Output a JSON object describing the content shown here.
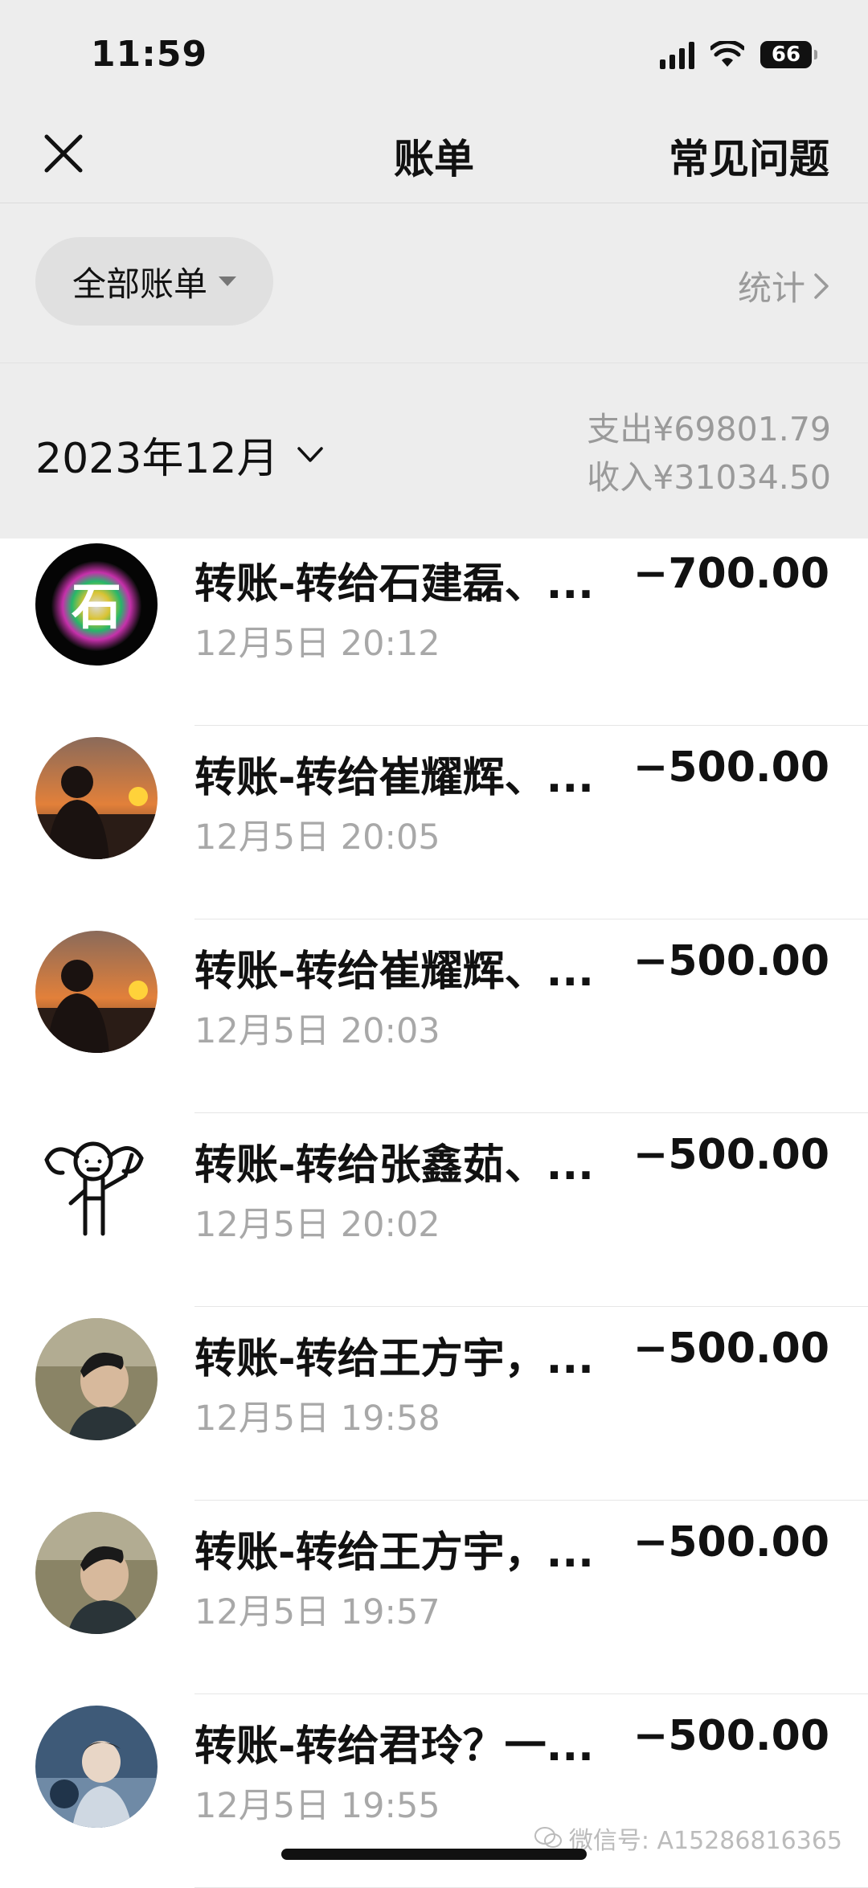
{
  "status_bar": {
    "time": "11:59",
    "battery": "66"
  },
  "nav": {
    "title": "账单",
    "right_label": "常见问题"
  },
  "filter": {
    "label": "全部账单",
    "stats_label": "统计"
  },
  "month": {
    "label": "2023年12月",
    "expense": "支出¥69801.79",
    "income": "收入¥31034.50"
  },
  "transactions": [
    {
      "title": "转账-转给石建磊、...",
      "amount": "−700.00",
      "time": "12月5日 20:12",
      "avatar": "avatar-shi"
    },
    {
      "title": "转账-转给崔耀辉、...",
      "amount": "−500.00",
      "time": "12月5日 20:05",
      "avatar": "avatar-sunset"
    },
    {
      "title": "转账-转给崔耀辉、...",
      "amount": "−500.00",
      "time": "12月5日 20:03",
      "avatar": "avatar-sunset"
    },
    {
      "title": "转账-转给张鑫茹、...",
      "amount": "−500.00",
      "time": "12月5日 20:02",
      "avatar": "avatar-doodle"
    },
    {
      "title": "转账-转给王方宇，...",
      "amount": "−500.00",
      "time": "12月5日 19:58",
      "avatar": "avatar-photo"
    },
    {
      "title": "转账-转给王方宇，...",
      "amount": "−500.00",
      "time": "12月5日 19:57",
      "avatar": "avatar-photo"
    },
    {
      "title": "转账-转给君玲？一...",
      "amount": "−500.00",
      "time": "12月5日 19:55",
      "avatar": "avatar-child"
    }
  ],
  "watermark": "微信号: A15286816365",
  "colors": {
    "background": "#ededed",
    "secondary_text": "#9a9a9a"
  }
}
